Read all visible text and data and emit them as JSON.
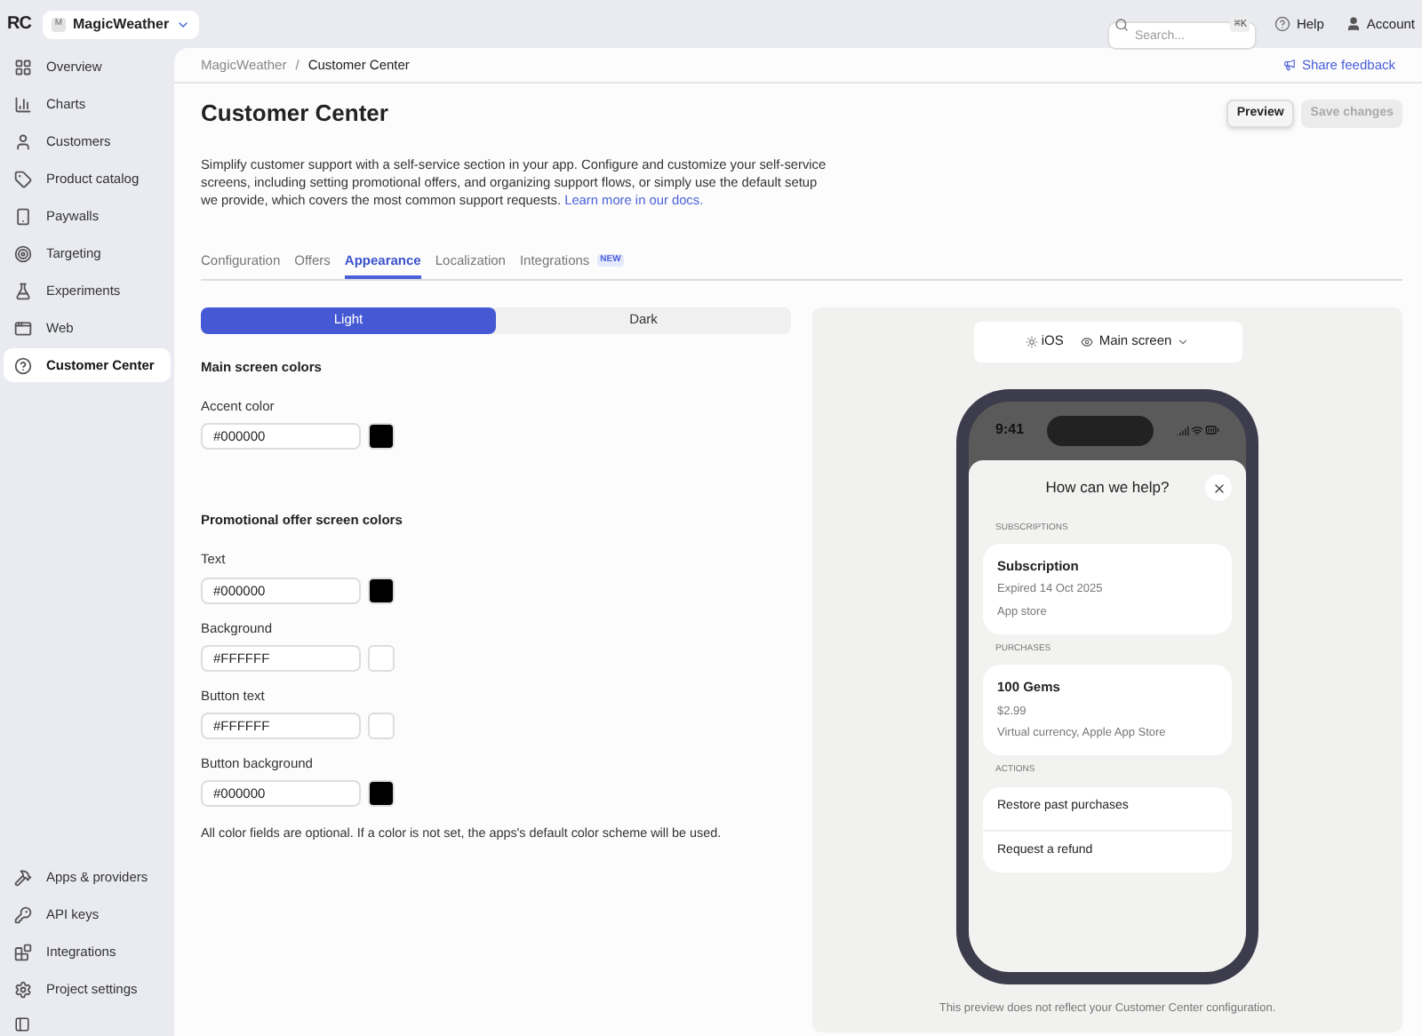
{
  "topbar": {
    "project": "MagicWeather",
    "project_initial": "M",
    "search_placeholder": "Search...",
    "shortcut": "⌘K",
    "help": "Help",
    "account": "Account"
  },
  "sidebar": {
    "logo": "RC",
    "items": [
      {
        "label": "Overview",
        "selected": false
      },
      {
        "label": "Charts",
        "selected": false
      },
      {
        "label": "Customers",
        "selected": false
      },
      {
        "label": "Product catalog",
        "selected": false
      },
      {
        "label": "Paywalls",
        "selected": false
      },
      {
        "label": "Targeting",
        "selected": false
      },
      {
        "label": "Experiments",
        "selected": false
      },
      {
        "label": "Web",
        "selected": false
      },
      {
        "label": "Customer Center",
        "selected": true
      }
    ],
    "bottom_items": [
      {
        "label": "Apps & providers"
      },
      {
        "label": "API keys"
      },
      {
        "label": "Integrations"
      },
      {
        "label": "Project settings"
      }
    ]
  },
  "breadcrumb": [
    "MagicWeather",
    "/",
    "Customer Center"
  ],
  "share_feedback": "Share feedback",
  "title": "Customer Center",
  "buttons": [
    {
      "label": "Preview",
      "disabled": false
    },
    {
      "label": "Save changes",
      "disabled": true
    }
  ],
  "description": "Simplify customer support with a self-service section in your app. Configure and customize your self-service screens, including setting promotional offers, and organizing support flows, or simply use the default setup we provide, which covers the most common support requests.",
  "docs_link": "Learn more in our docs.",
  "tabs": [
    {
      "label": "Configuration",
      "selected": false
    },
    {
      "label": "Offers",
      "selected": false
    },
    {
      "label": "Appearance",
      "selected": true
    },
    {
      "label": "Localization",
      "selected": false
    },
    {
      "label": "Integrations",
      "selected": false,
      "badge": "NEW"
    }
  ],
  "mode": [
    {
      "label": "Light",
      "selected": true
    },
    {
      "label": "Dark",
      "selected": false
    }
  ],
  "sections": [
    {
      "title": "Main screen colors",
      "fields": [
        {
          "label": "Accent color",
          "value": "#000000",
          "color": "#000000"
        }
      ]
    },
    {
      "title": "Promotional offer screen colors",
      "fields": [
        {
          "label": "Text",
          "value": "#000000",
          "color": "#000000"
        },
        {
          "label": "Background",
          "value": "#FFFFFF",
          "color": "#ffffff"
        },
        {
          "label": "Button text",
          "value": "#FFFFFF",
          "color": "#ffffff"
        },
        {
          "label": "Button background",
          "value": "#000000",
          "color": "#000000"
        }
      ]
    }
  ],
  "note": "All color fields are optional. If a color is not set, the apps's default color scheme will be used.",
  "preview": {
    "platform": "iOS",
    "screen": "Main screen",
    "time": "9:41",
    "heading": "How can we help?",
    "groups": [
      {
        "label": "SUBSCRIPTIONS",
        "kind": "card",
        "items": [
          {
            "title": "Subscription",
            "lines": [
              "Expired 14 Oct 2025",
              "App store"
            ]
          }
        ]
      },
      {
        "label": "PURCHASES",
        "kind": "card",
        "items": [
          {
            "title": "100 Gems",
            "lines": [
              "$2.99",
              "Virtual currency, Apple App Store"
            ]
          }
        ]
      },
      {
        "label": "ACTIONS",
        "kind": "list",
        "items": [
          {
            "title": "Restore past purchases"
          },
          {
            "title": "Request a refund"
          }
        ]
      }
    ],
    "footnote": "This preview does not reflect your Customer Center configuration."
  }
}
